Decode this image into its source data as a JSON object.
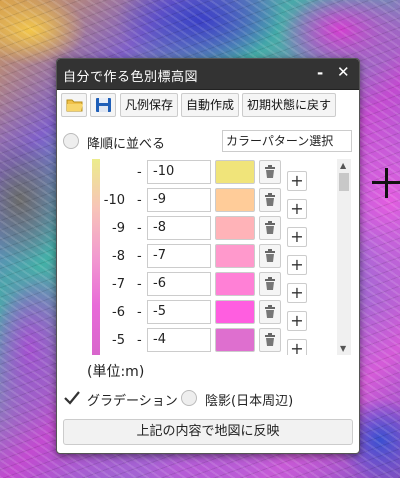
{
  "dialog": {
    "title": "自分で作る色別標高図",
    "minimize_glyph": "-",
    "close_glyph": "✕"
  },
  "toolbar": {
    "open_icon": "folder-open-icon",
    "save_icon": "floppy-disk-icon",
    "legend_save_label": "凡例保存",
    "auto_create_label": "自動作成",
    "reset_label": "初期状態に戻す"
  },
  "sort": {
    "label": "降順に並べる",
    "checked": false,
    "pattern_select_label": "カラーパターン選択"
  },
  "rows": [
    {
      "label": "",
      "value": "-10",
      "color": "#f0e47a"
    },
    {
      "label": "-10",
      "value": "-9",
      "color": "#ffcc99"
    },
    {
      "label": "-9",
      "value": "-8",
      "color": "#ffb3b8"
    },
    {
      "label": "-8",
      "value": "-7",
      "color": "#ff99cc"
    },
    {
      "label": "-7",
      "value": "-6",
      "color": "#ff80d6"
    },
    {
      "label": "-6",
      "value": "-5",
      "color": "#ff5ee0"
    },
    {
      "label": "-5",
      "value": "-4",
      "color": "#de6fcf"
    }
  ],
  "row_separator": "-",
  "plus_label": "+",
  "unit_label": "(単位:m)",
  "options": {
    "gradation_label": "グラデーション",
    "gradation_checked": true,
    "shade_label": "陰影(日本周辺)",
    "shade_checked": false
  },
  "apply_button_label": "上記の内容で地図に反映",
  "colors": {
    "titlebar_bg": "#333333",
    "gradient_top": "#ecec8c",
    "gradient_bottom": "#d866cc"
  }
}
